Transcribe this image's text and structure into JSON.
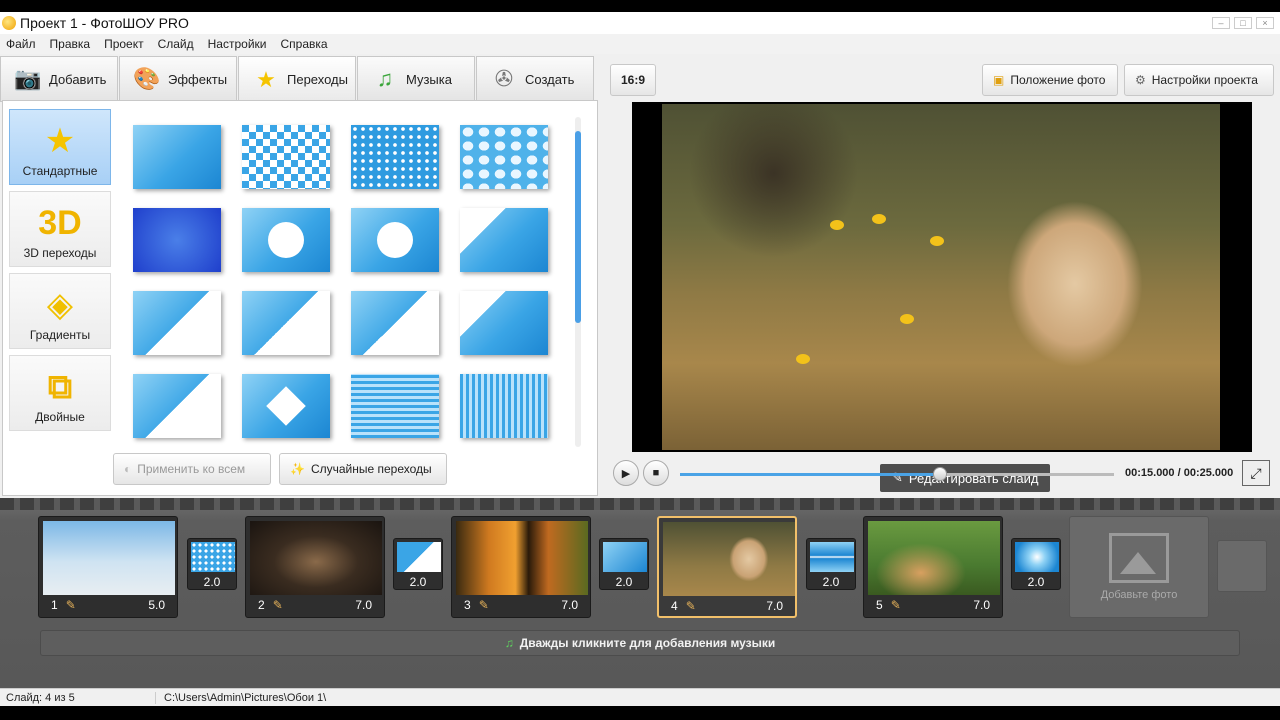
{
  "window": {
    "title": "Проект 1 - ФотоШОУ PRO"
  },
  "menu": [
    "Файл",
    "Правка",
    "Проект",
    "Слайд",
    "Настройки",
    "Справка"
  ],
  "tabs": [
    {
      "label": "Добавить",
      "icon": "camera-icon"
    },
    {
      "label": "Эффекты",
      "icon": "palette-icon"
    },
    {
      "label": "Переходы",
      "icon": "star-icon",
      "active": true
    },
    {
      "label": "Музыка",
      "icon": "music-note-icon"
    },
    {
      "label": "Создать",
      "icon": "film-reel-icon"
    }
  ],
  "categories": [
    {
      "label": "Стандартные",
      "glyph": "★",
      "active": true
    },
    {
      "label": "3D переходы",
      "glyph": "3D"
    },
    {
      "label": "Градиенты",
      "glyph": "◈"
    },
    {
      "label": "Двойные",
      "glyph": "⧉"
    }
  ],
  "transitions_panel": {
    "apply_all_label": "Применить ко всем",
    "random_label": "Случайные переходы"
  },
  "preview": {
    "aspect_label": "16:9",
    "photo_position_label": "Положение фото",
    "project_settings_label": "Настройки проекта",
    "edit_slide_label": "Редактировать слайд",
    "time": "00:15.000 / 00:25.000",
    "progress": 0.6
  },
  "timeline": {
    "slides": [
      {
        "num": "1",
        "duration": "5.0"
      },
      {
        "num": "2",
        "duration": "7.0"
      },
      {
        "num": "3",
        "duration": "7.0"
      },
      {
        "num": "4",
        "duration": "7.0",
        "active": true
      },
      {
        "num": "5",
        "duration": "7.0"
      }
    ],
    "transitions": [
      "2.0",
      "2.0",
      "2.0",
      "2.0",
      "2.0"
    ],
    "add_photo_label": "Добавьте фото",
    "music_hint": "Дважды кликните для добавления музыки"
  },
  "status": {
    "slide_info": "Слайд: 4 из 5",
    "path": "C:\\Users\\Admin\\Pictures\\Обои 1\\"
  }
}
